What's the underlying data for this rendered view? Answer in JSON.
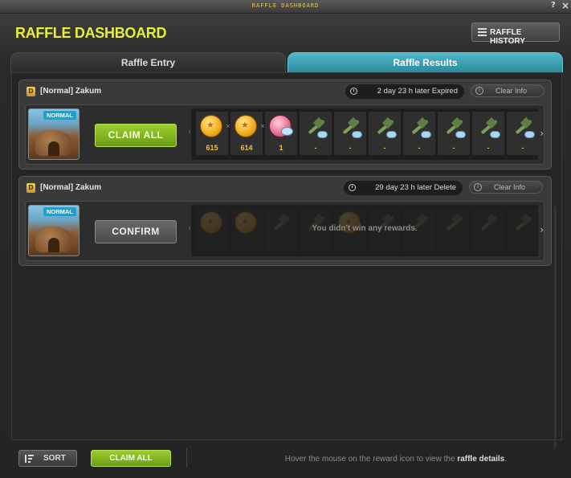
{
  "window": {
    "title": "RAFFLE DASHBOARD",
    "help": "?",
    "close": "×"
  },
  "header": {
    "title": "RAFFLE DASHBOARD",
    "history_label": "RAFFLE HISTORY"
  },
  "tabs": [
    {
      "label": "Raffle Entry",
      "active": false
    },
    {
      "label": "Raffle Results",
      "active": true
    }
  ],
  "cards": [
    {
      "badge": "D",
      "name": "[Normal] Zakum",
      "timer": "2 day 23 h later Expired",
      "clear_label": "Clear Info",
      "thumb_tag": "NORMAL",
      "action_label": "CLAIM ALL",
      "rewards": [
        {
          "icon": "gold-coin-icon",
          "qty": "615"
        },
        {
          "icon": "gold-coin-icon",
          "qty": "614"
        },
        {
          "icon": "pink-orb-icon",
          "qty": "1"
        },
        {
          "icon": "weapon-icon",
          "qty": "-"
        },
        {
          "icon": "weapon-icon",
          "qty": "-"
        },
        {
          "icon": "weapon-icon",
          "qty": "-"
        },
        {
          "icon": "weapon-icon",
          "qty": "-"
        },
        {
          "icon": "weapon-icon",
          "qty": "-"
        },
        {
          "icon": "weapon-icon",
          "qty": "-"
        },
        {
          "icon": "weapon-icon",
          "qty": "-"
        }
      ]
    },
    {
      "badge": "D",
      "name": "[Normal] Zakum",
      "timer": "29 day 23 h later Delete",
      "clear_label": "Clear Info",
      "thumb_tag": "NORMAL",
      "action_label": "CONFIRM",
      "no_rewards": "You didn't win any rewards."
    }
  ],
  "footer": {
    "sort_label": "SORT",
    "claim_all_label": "CLAIM ALL",
    "hint_prefix": "Hover the mouse on the reward icon to view the",
    "hint_bold": "raffle details",
    "hint_suffix": "."
  },
  "colors": {
    "accent_title": "#e8ee39",
    "tab_active": "#3aa4b8",
    "button_green": "#8bc424",
    "qty_gold": "#f0c040"
  }
}
